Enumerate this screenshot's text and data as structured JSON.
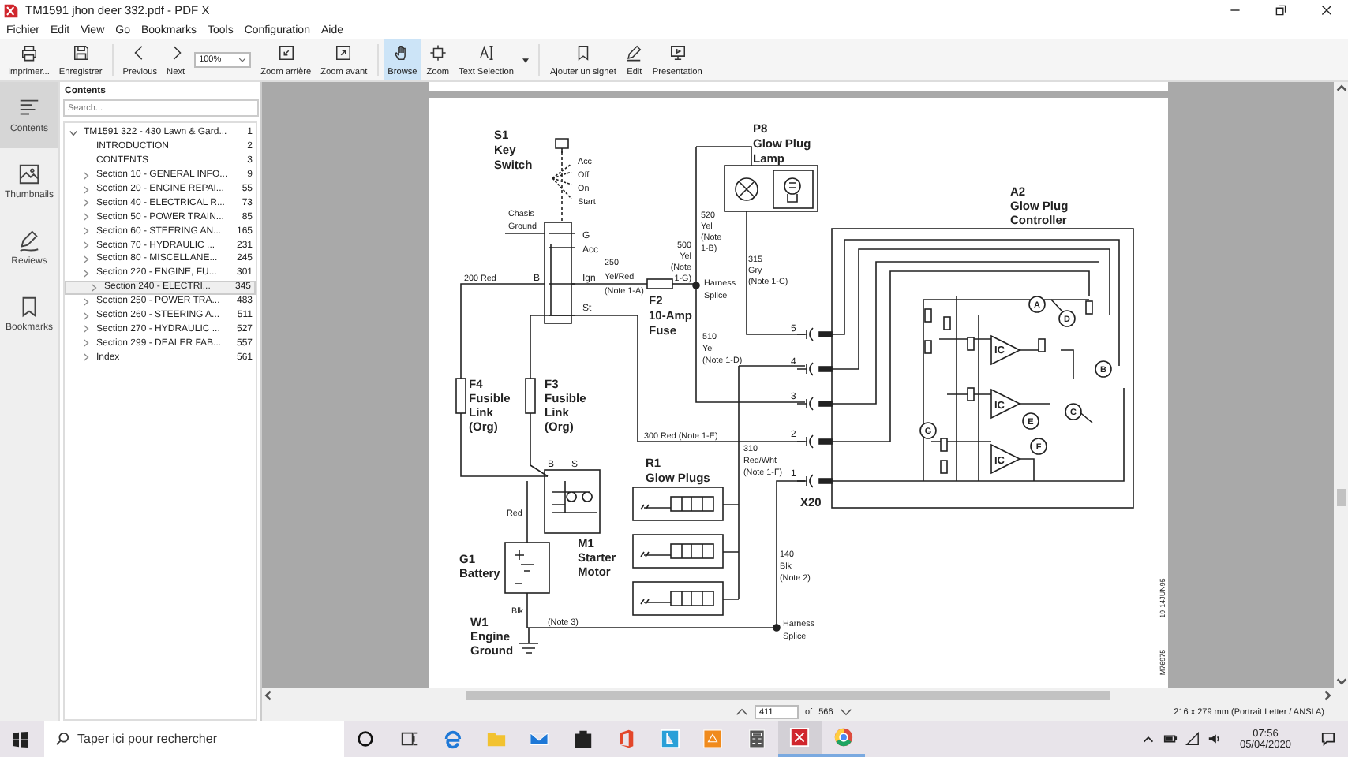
{
  "window": {
    "title": "TM1591 jhon deer 332.pdf  - PDF X"
  },
  "menu": [
    "Fichier",
    "Edit",
    "View",
    "Go",
    "Bookmarks",
    "Tools",
    "Configuration",
    "Aide"
  ],
  "toolbar": {
    "groups": [
      [
        {
          "kind": "button",
          "label": "Imprimer...",
          "selected": false
        },
        {
          "kind": "button",
          "label": "Enregistrer",
          "selected": false
        }
      ],
      [
        {
          "kind": "button",
          "label": "Previous",
          "selected": false
        },
        {
          "kind": "button",
          "label": "Next",
          "selected": false
        },
        {
          "kind": "field",
          "value": "100%"
        },
        {
          "kind": "button",
          "label": "Zoom arrière",
          "selected": false
        },
        {
          "kind": "button",
          "label": "Zoom avant",
          "selected": false
        }
      ],
      [
        {
          "kind": "button",
          "label": "Browse",
          "selected": true
        },
        {
          "kind": "button",
          "label": "Zoom",
          "selected": false
        },
        {
          "kind": "dropdown",
          "label": "Text Selection",
          "selected": false
        }
      ],
      [
        {
          "kind": "button",
          "label": "Ajouter un signet",
          "selected": false
        },
        {
          "kind": "button",
          "label": "Edit",
          "selected": false
        },
        {
          "kind": "button",
          "label": "Presentation",
          "selected": false
        }
      ]
    ]
  },
  "rail": [
    {
      "label": "Contents",
      "selected": true
    },
    {
      "label": "Thumbnails",
      "selected": false
    },
    {
      "label": "Reviews",
      "selected": false
    },
    {
      "label": "Bookmarks",
      "selected": false
    }
  ],
  "contents": {
    "title": "Contents",
    "search": {
      "placeholder": "Search..."
    },
    "tree": [
      {
        "label": "TM1591 322 - 430 Lawn & Gard...",
        "page": "1",
        "kind": "branch",
        "expanded": true,
        "selected": false,
        "children": [
          {
            "label": "INTRODUCTION",
            "page": "2",
            "kind": "leaf",
            "selected": false
          },
          {
            "label": "CONTENTS",
            "page": "3",
            "kind": "leaf",
            "selected": false
          },
          {
            "label": "Section 10 - GENERAL INFO...",
            "page": "9",
            "kind": "branch",
            "expanded": false,
            "selected": false
          },
          {
            "label": "Section 20 - ENGINE REPAI...",
            "page": "55",
            "kind": "branch",
            "expanded": false,
            "selected": false
          },
          {
            "label": "Section 40 - ELECTRICAL R...",
            "page": "73",
            "kind": "branch",
            "expanded": false,
            "selected": false
          },
          {
            "label": "Section 50 - POWER TRAIN...",
            "page": "85",
            "kind": "branch",
            "expanded": false,
            "selected": false
          },
          {
            "label": "Section 60 - STEERING AN...",
            "page": "165",
            "kind": "branch",
            "expanded": false,
            "selected": false
          },
          {
            "label": "Section 70 - HYDRAULIC ...",
            "page": "231",
            "kind": "branch",
            "expanded": false,
            "selected": false
          },
          {
            "label": "Section 80 - MISCELLANE...",
            "page": "245",
            "kind": "branch",
            "expanded": false,
            "selected": false
          },
          {
            "label": "Section 220 - ENGINE, FU...",
            "page": "301",
            "kind": "branch",
            "expanded": false,
            "selected": false
          },
          {
            "label": "Section 240 - ELECTRI...",
            "page": "345",
            "kind": "branch",
            "expanded": false,
            "selected": true
          },
          {
            "label": "Section 250 - POWER TRA...",
            "page": "483",
            "kind": "branch",
            "expanded": false,
            "selected": false
          },
          {
            "label": "Section 260 - STEERING A...",
            "page": "511",
            "kind": "branch",
            "expanded": false,
            "selected": false
          },
          {
            "label": "Section 270 - HYDRAULIC ...",
            "page": "527",
            "kind": "branch",
            "expanded": false,
            "selected": false
          },
          {
            "label": "Section 299 - DEALER FAB...",
            "page": "557",
            "kind": "branch",
            "expanded": false,
            "selected": false
          },
          {
            "label": "Index",
            "page": "561",
            "kind": "branch",
            "expanded": false,
            "selected": false
          }
        ]
      }
    ]
  },
  "diagram": {
    "labels": [
      {
        "kind": "title",
        "lines": [
          "S1",
          "Key",
          "Switch"
        ]
      },
      {
        "kind": "note",
        "lines": [
          "Acc",
          "Off",
          "On",
          "Start"
        ]
      },
      {
        "kind": "note",
        "lines": [
          "Chasis",
          "Ground"
        ]
      },
      {
        "kind": "pin",
        "lines": [
          "G"
        ]
      },
      {
        "kind": "pin",
        "lines": [
          "Acc"
        ]
      },
      {
        "kind": "pin",
        "lines": [
          "B"
        ]
      },
      {
        "kind": "pin",
        "lines": [
          "Ign"
        ]
      },
      {
        "kind": "pin",
        "lines": [
          "St"
        ]
      },
      {
        "kind": "note",
        "lines": [
          "200 Red"
        ]
      },
      {
        "kind": "note",
        "lines": [
          "250",
          "Yel/Red",
          "(Note 1-A)"
        ]
      },
      {
        "kind": "note",
        "lines": [
          "500",
          "Yel",
          "(Note",
          "1-G)"
        ]
      },
      {
        "kind": "title",
        "lines": [
          "F2",
          "10-Amp",
          "Fuse"
        ]
      },
      {
        "kind": "note",
        "lines": [
          "520",
          "Yel",
          "(Note",
          "1-B)"
        ]
      },
      {
        "kind": "title",
        "lines": [
          "P8",
          "Glow Plug",
          "Lamp"
        ]
      },
      {
        "kind": "note",
        "lines": [
          "315",
          "Gry",
          "(Note 1-C)"
        ]
      },
      {
        "kind": "note",
        "lines": [
          "Harness",
          "Splice"
        ]
      },
      {
        "kind": "note",
        "lines": [
          "510",
          "Yel",
          "(Note 1-D)"
        ]
      },
      {
        "kind": "title",
        "lines": [
          "A2",
          "Glow Plug",
          "Controller"
        ]
      },
      {
        "kind": "pin",
        "lines": [
          "5"
        ]
      },
      {
        "kind": "pin",
        "lines": [
          "4"
        ]
      },
      {
        "kind": "pin",
        "lines": [
          "3"
        ]
      },
      {
        "kind": "pin",
        "lines": [
          "2"
        ]
      },
      {
        "kind": "pin",
        "lines": [
          "1"
        ]
      },
      {
        "kind": "title",
        "lines": [
          "F4",
          "Fusible",
          "Link",
          "(Org)"
        ]
      },
      {
        "kind": "title",
        "lines": [
          "F3",
          "Fusible",
          "Link",
          "(Org)"
        ]
      },
      {
        "kind": "note",
        "lines": [
          "300 Red (Note 1-E)"
        ]
      },
      {
        "kind": "note",
        "lines": [
          "310",
          "Red/Wht",
          "(Note 1-F)"
        ]
      },
      {
        "kind": "title",
        "lines": [
          "R1",
          "Glow Plugs"
        ]
      },
      {
        "kind": "title",
        "lines": [
          "X20"
        ]
      },
      {
        "kind": "pin",
        "lines": [
          "B"
        ]
      },
      {
        "kind": "pin",
        "lines": [
          "S"
        ]
      },
      {
        "kind": "note",
        "lines": [
          "Red"
        ]
      },
      {
        "kind": "title",
        "lines": [
          "G1",
          "Battery"
        ]
      },
      {
        "kind": "title",
        "lines": [
          "M1",
          "Starter",
          "Motor"
        ]
      },
      {
        "kind": "note",
        "lines": [
          "140",
          "Blk",
          "(Note 2)"
        ]
      },
      {
        "kind": "note",
        "lines": [
          "Blk"
        ]
      },
      {
        "kind": "title",
        "lines": [
          "W1",
          "Engine",
          "Ground"
        ]
      },
      {
        "kind": "note",
        "lines": [
          "(Note 3)"
        ]
      },
      {
        "kind": "note",
        "lines": [
          "Harness",
          "Splice"
        ]
      },
      {
        "kind": "ic",
        "lines": [
          "IC"
        ]
      },
      {
        "kind": "ic",
        "lines": [
          "IC"
        ]
      },
      {
        "kind": "ic",
        "lines": [
          "IC"
        ]
      },
      {
        "kind": "callout",
        "lines": [
          "A"
        ]
      },
      {
        "kind": "callout",
        "lines": [
          "D"
        ]
      },
      {
        "kind": "callout",
        "lines": [
          "B"
        ]
      },
      {
        "kind": "callout",
        "lines": [
          "C"
        ]
      },
      {
        "kind": "callout",
        "lines": [
          "E"
        ]
      },
      {
        "kind": "callout",
        "lines": [
          "G"
        ]
      },
      {
        "kind": "callout",
        "lines": [
          "F"
        ]
      },
      {
        "kind": "vertical",
        "lines": [
          "-19-14JUN95"
        ]
      },
      {
        "kind": "vertical",
        "lines": [
          "M76975"
        ]
      }
    ]
  },
  "status": {
    "page": "411",
    "of": "of",
    "total": "566",
    "size": "216 x 279 mm (Portrait Letter / ANSI A)"
  },
  "taskbar": {
    "search": {
      "placeholder": "Taper ici pour rechercher"
    },
    "apps": [
      {
        "running": false,
        "selected": false
      },
      {
        "running": false,
        "selected": false
      },
      {
        "running": false,
        "selected": false
      },
      {
        "running": false,
        "selected": false
      },
      {
        "running": false,
        "selected": false
      },
      {
        "running": false,
        "selected": false
      },
      {
        "running": false,
        "selected": false
      },
      {
        "running": false,
        "selected": false
      },
      {
        "running": false,
        "selected": false
      },
      {
        "running": false,
        "selected": false
      },
      {
        "running": true,
        "selected": true
      },
      {
        "running": true,
        "selected": false
      }
    ],
    "time": "07:56",
    "date": "05/04/2020"
  }
}
